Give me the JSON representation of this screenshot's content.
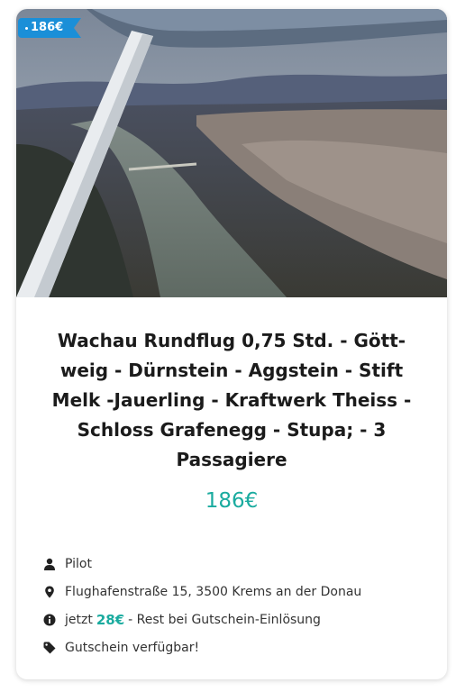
{
  "badge": {
    "price": "186€"
  },
  "offer": {
    "title": "Wachau Rundflug 0,75 Std. - Gött-weig - Dürnstein - Aggstein - Stift Melk -Jauerling - Kraftwerk Theiss - Schloss Grafenegg - Stupa; - 3 Passagiere",
    "price": "186€"
  },
  "details": {
    "provider": "Pilot",
    "address": "Flughafenstraße 15, 3500 Krems an der Donau",
    "deposit_prefix": "jetzt",
    "deposit_amount": "28€",
    "deposit_suffix": "- Rest bei Gutschein-Einlösung",
    "availability": "Gutschein verfügbar!"
  },
  "icons": {
    "provider": "user-icon",
    "address": "map-marker-icon",
    "deposit": "info-circle-icon",
    "availability": "tag-icon"
  },
  "colors": {
    "accent": "#1aab9f",
    "badge": "#1a8fd8",
    "text": "#1b1b1b"
  }
}
